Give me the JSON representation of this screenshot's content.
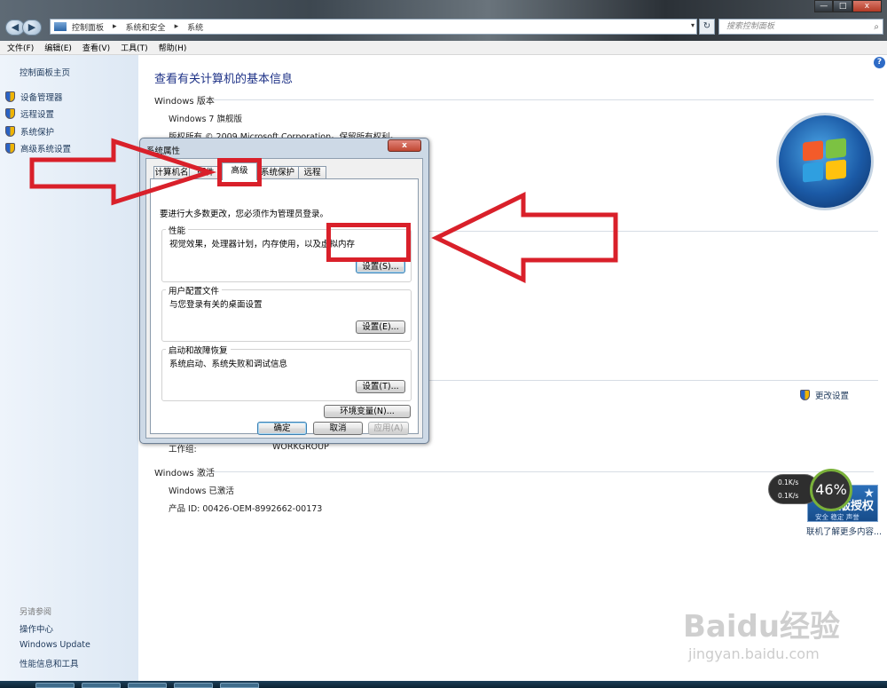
{
  "window": {
    "nav_back": "◀",
    "nav_forward": "▶",
    "nav_recent": "▾",
    "breadcrumb": [
      "控制面板",
      "系统和安全",
      "系统"
    ],
    "address_dropdown": "▾",
    "refresh": "↻",
    "search_placeholder": "搜索控制面板",
    "search_icon": "search-icon",
    "buttons": {
      "minimize": "—",
      "maximize": "□",
      "close": "x"
    }
  },
  "menu": [
    "文件(F)",
    "编辑(E)",
    "查看(V)",
    "工具(T)",
    "帮助(H)"
  ],
  "left_pane": {
    "home": "控制面板主页",
    "tasks": [
      "设备管理器",
      "远程设置",
      "系统保护",
      "高级系统设置"
    ],
    "see_also_title": "另请参阅",
    "see_also": [
      "操作中心",
      "Windows Update",
      "性能信息和工具"
    ]
  },
  "main": {
    "title": "查看有关计算机的基本信息",
    "help": "?",
    "windows_edition_heading": "Windows 版本",
    "edition": "Windows 7 旗舰版",
    "copyright": "版权所有 © 2009 Microsoft Corporation。保留所有权利。",
    "change_settings": "更改设置",
    "workgroup_label": "工作组:",
    "workgroup_value": "WORKGROUP",
    "activation_heading": "Windows 激活",
    "activated": "Windows 已激活",
    "product_id": "产品 ID: 00426-OEM-8992662-00173",
    "badge_big": "正版授权",
    "badge_small": "安全 稳定 声誉",
    "more_link": "联机了解更多内容...",
    "net_up": "0.1K/s",
    "net_down": "0.1K/s",
    "cpu_percent": "46%"
  },
  "dialog": {
    "title": "系统属性",
    "close": "x",
    "tabs": [
      "计算机名",
      "硬件",
      "高级",
      "系统保护",
      "远程"
    ],
    "active_tab": "高级",
    "admin_note": "要进行大多数更改，您必须作为管理员登录。",
    "groups": [
      {
        "title": "性能",
        "desc": "视觉效果，处理器计划，内存使用，以及虚拟内存",
        "button": "设置(S)..."
      },
      {
        "title": "用户配置文件",
        "desc": "与您登录有关的桌面设置",
        "button": "设置(E)..."
      },
      {
        "title": "启动和故障恢复",
        "desc": "系统启动、系统失败和调试信息",
        "button": "设置(T)..."
      }
    ],
    "env_button": "环境变量(N)...",
    "ok": "确定",
    "cancel": "取消",
    "apply": "应用(A)"
  },
  "watermark": {
    "logo": "Baidu经验",
    "url": "jingyan.baidu.com"
  },
  "colors": {
    "annotation_red": "#d9202a",
    "link": "#1e395b",
    "title_blue": "#1e3287"
  }
}
